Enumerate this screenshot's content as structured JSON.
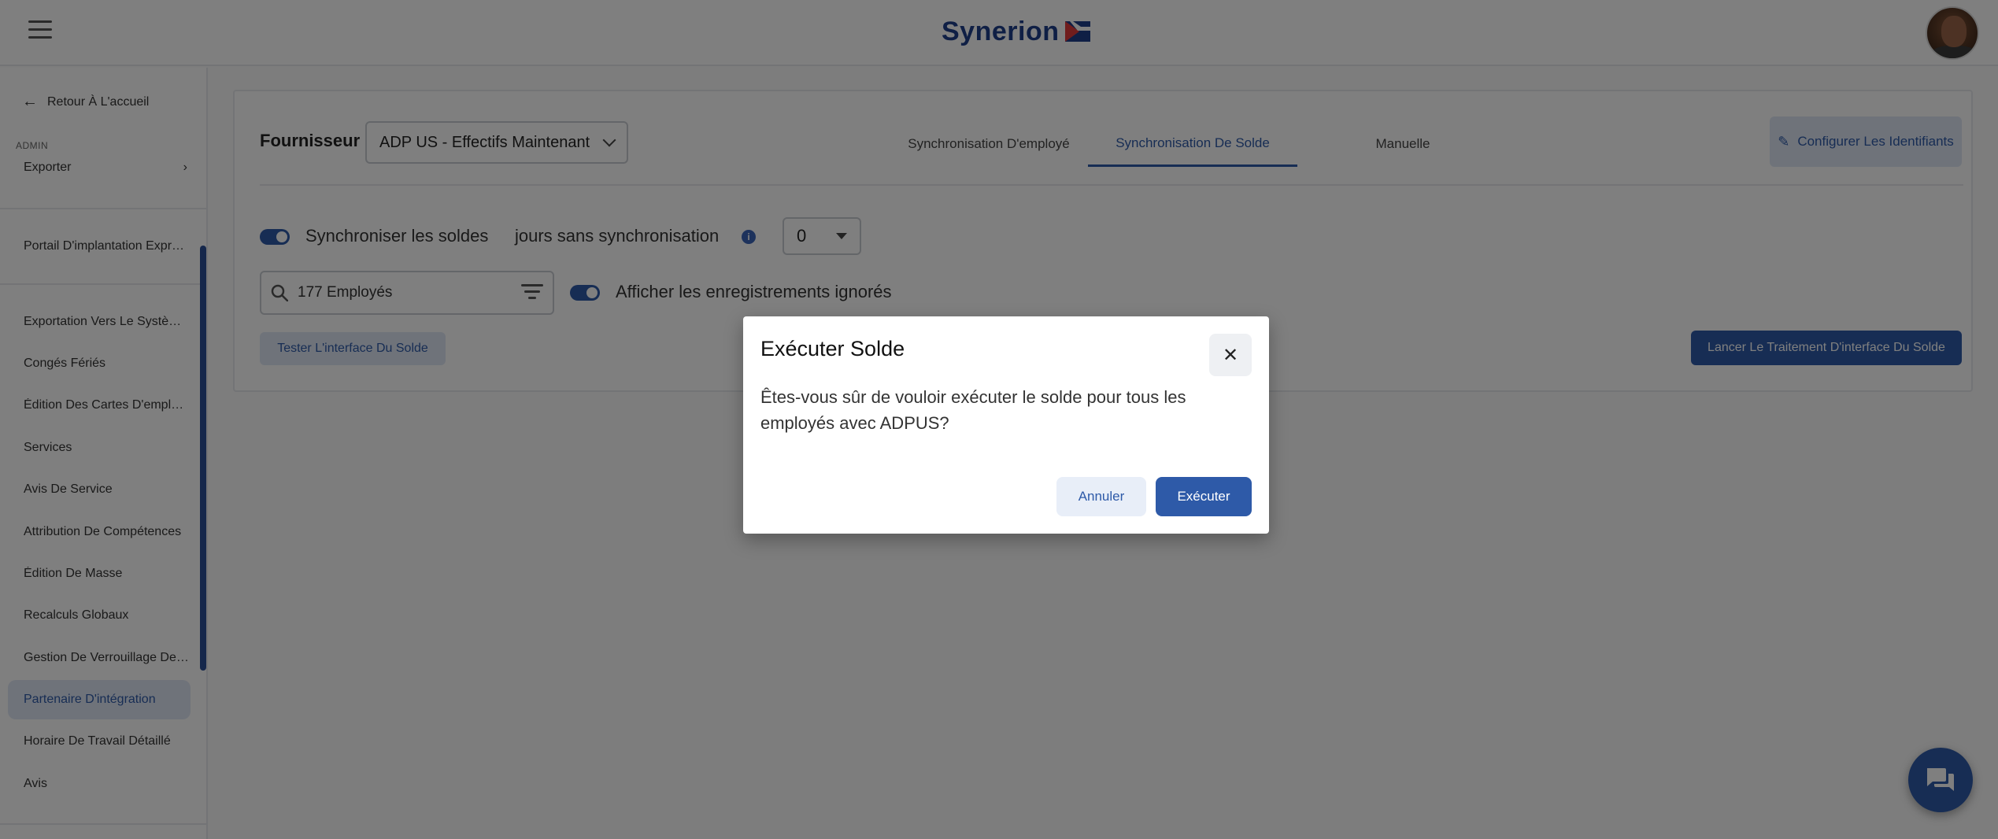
{
  "header": {
    "logo_text": "Synerion",
    "menu_icon": "hamburger-menu-icon",
    "avatar_icon": "user-avatar"
  },
  "sidebar": {
    "back_label": "Retour À L'accueil",
    "admin_label": "ADMIN",
    "export_label": "Exporter",
    "portal_label": "Portail D'implantation Expr…",
    "items": [
      "Exportation Vers Le Systè…",
      "Congés Fériés",
      "Édition Des Cartes D'empl…",
      "Services",
      "Avis De Service",
      "Attribution De Compétences",
      "Édition De Masse",
      "Recalculs Globaux",
      "Gestion De Verrouillage De…",
      "Partenaire D'intégration",
      "Horaire De Travail Détaillé",
      "Avis"
    ],
    "active_item": "Partenaire D'intégration"
  },
  "main": {
    "provider_label": "Fournisseur",
    "provider_value": "ADP US - Effectifs Maintenant",
    "tabs": [
      {
        "label": "Synchronisation D'employé",
        "active": false
      },
      {
        "label": "Synchronisation De Solde",
        "active": true
      },
      {
        "label": "Manuelle",
        "active": false
      }
    ],
    "configure_label": "Configurer Les Identifiants",
    "sync_balances_label": "Synchroniser les soldes",
    "days_without_sync_label": "jours sans synchronisation",
    "days_value": "0",
    "search_value": "177 Employés",
    "show_ignored_label": "Afficher les enregistrements ignorés",
    "test_button": "Tester L'interface Du Solde",
    "run_button": "Lancer Le Traitement D'interface Du Solde"
  },
  "dialog": {
    "title": "Exécuter Solde",
    "body": "Êtes-vous sûr de vouloir exécuter le solde pour tous les employés avec ADPUS?",
    "cancel": "Annuler",
    "confirm": "Exécuter"
  },
  "colors": {
    "accent": "#2e5aa8",
    "accent_light": "#dfe7f5",
    "overlay": "rgba(0,0,0,0.5)"
  }
}
